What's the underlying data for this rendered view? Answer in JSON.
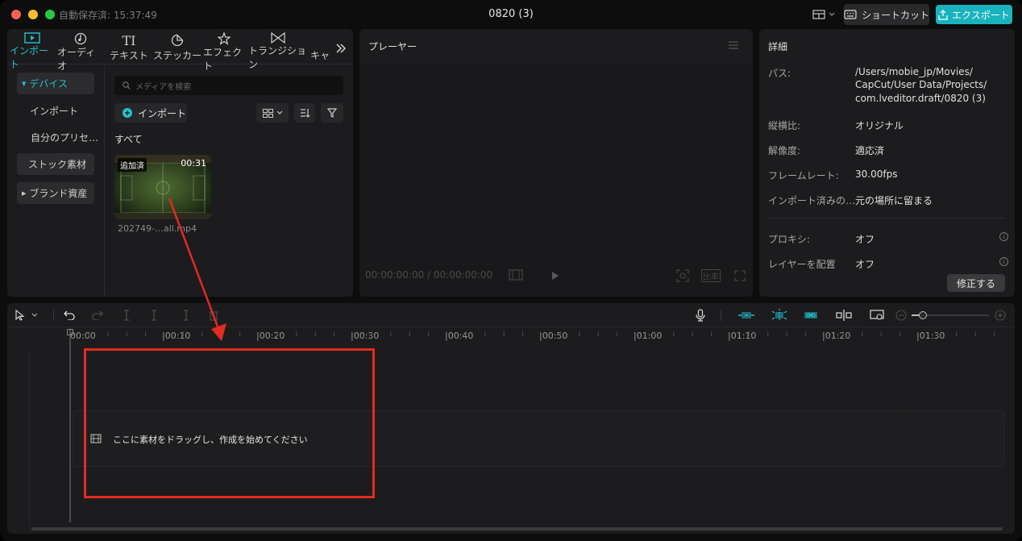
{
  "window": {
    "autosave": "自動保存済: 15:37:49",
    "title": "0820 (3)",
    "shortcut_label": "ショートカット",
    "export_label": "エクスポート"
  },
  "media": {
    "tabs": [
      {
        "label": "インポート",
        "icon": "import-icon",
        "active": true
      },
      {
        "label": "オーディオ",
        "icon": "audio-icon"
      },
      {
        "label": "テキスト",
        "icon": "text-icon"
      },
      {
        "label": "ステッカー",
        "icon": "sticker-icon"
      },
      {
        "label": "エフェクト",
        "icon": "effect-icon"
      },
      {
        "label": "トランジション",
        "icon": "transition-icon"
      },
      {
        "label": "キャ",
        "icon": ""
      }
    ],
    "sidebar": {
      "device": "デバイス",
      "import": "インポート",
      "my_presets": "自分のプリセ…",
      "stock": "ストック素材",
      "brand": "ブランド資産"
    },
    "search_placeholder": "メディアを検索",
    "import_label": "インポート",
    "all_label": "すべて",
    "clip": {
      "badge": "追加済",
      "duration": "00:31",
      "name": "202749-…all.mp4"
    }
  },
  "player": {
    "title": "プレーヤー",
    "timecode": "00:00:00:00 / 00:00:00:00",
    "ratio_label": "比率"
  },
  "details": {
    "title": "詳細",
    "rows": [
      {
        "key": "パス:",
        "value": "/Users/mobie_jp/Movies/"
      },
      {
        "key": "",
        "value": "CapCut/User Data/Projects/"
      },
      {
        "key": "",
        "value": "com.lveditor.draft/0820 (3)"
      },
      {
        "key": "縦横比:",
        "value": "オリジナル"
      },
      {
        "key": "解像度:",
        "value": "適応済"
      },
      {
        "key": "フレームレート:",
        "value": "30.00fps"
      },
      {
        "key": "インポート済みの…",
        "value": "元の場所に留まる"
      },
      {
        "key": "プロキシ:",
        "value": "オフ"
      },
      {
        "key": "レイヤーを配置",
        "value": "オフ"
      }
    ],
    "fix_label": "修正する"
  },
  "timeline": {
    "ticks": [
      "00:00",
      "|00:10",
      "|00:20",
      "|00:30",
      "|00:40",
      "|00:50",
      "|01:00",
      "|01:10",
      "|01:20",
      "|01:30"
    ],
    "drop_hint": "ここに素材をドラッグし、作成を始めてください"
  },
  "colors": {
    "accent": "#22c3cf",
    "export_bg": "#1ab3bd",
    "annotation": "#e32b20"
  }
}
